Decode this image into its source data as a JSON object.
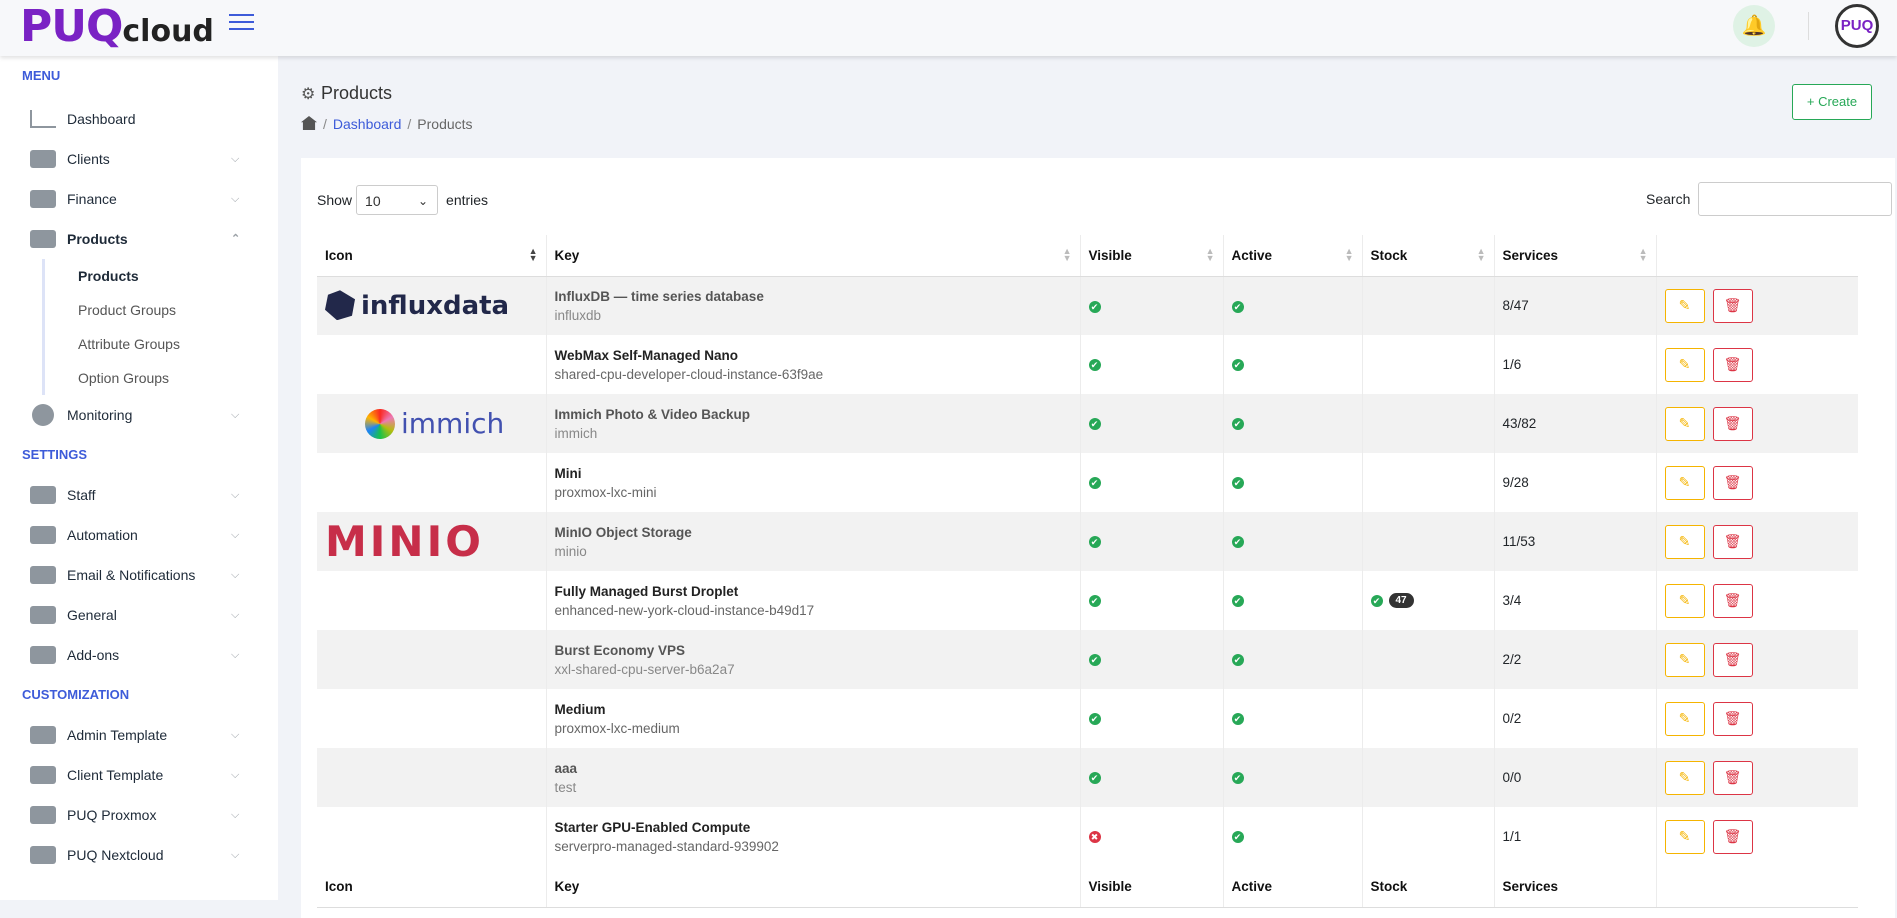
{
  "brand": {
    "logo_main": "PUQ",
    "logo_sub": "cloud"
  },
  "header": {
    "avatar_text": "PUQ"
  },
  "sidebar": {
    "sections": {
      "menu": "MENU",
      "settings": "SETTINGS",
      "customization": "CUSTOMIZATION"
    },
    "menu_items": [
      {
        "label": "Dashboard"
      },
      {
        "label": "Clients"
      },
      {
        "label": "Finance"
      },
      {
        "label": "Products"
      }
    ],
    "product_sub": [
      {
        "label": "Products"
      },
      {
        "label": "Product Groups"
      },
      {
        "label": "Attribute Groups"
      },
      {
        "label": "Option Groups"
      }
    ],
    "monitoring": {
      "label": "Monitoring"
    },
    "settings_items": [
      {
        "label": "Staff"
      },
      {
        "label": "Automation"
      },
      {
        "label": "Email & Notifications"
      },
      {
        "label": "General"
      },
      {
        "label": "Add-ons"
      }
    ],
    "custom_items": [
      {
        "label": "Admin Template"
      },
      {
        "label": "Client Template"
      },
      {
        "label": "PUQ Proxmox"
      },
      {
        "label": "PUQ Nextcloud"
      }
    ]
  },
  "page": {
    "title": "Products",
    "breadcrumb": {
      "dashboard": "Dashboard",
      "current": "Products"
    },
    "create_label": "+ Create"
  },
  "table_controls": {
    "show_label": "Show",
    "entries_value": "10",
    "entries_label": "entries",
    "search_label": "Search"
  },
  "table": {
    "headers": {
      "icon": "Icon",
      "key": "Key",
      "visible": "Visible",
      "active": "Active",
      "stock": "Stock",
      "services": "Services"
    },
    "rows": [
      {
        "logo": "influxdata",
        "title": "InfluxDB — time series database",
        "key": "influxdb",
        "visible": true,
        "active": true,
        "stock": "",
        "services": "8/47"
      },
      {
        "logo": "",
        "title": "WebMax Self-Managed Nano",
        "key": "shared-cpu-developer-cloud-instance-63f9ae",
        "visible": true,
        "active": true,
        "stock": "",
        "services": "1/6"
      },
      {
        "logo": "immich",
        "title": "Immich Photo & Video Backup",
        "key": "immich",
        "visible": true,
        "active": true,
        "stock": "",
        "services": "43/82"
      },
      {
        "logo": "",
        "title": "Mini",
        "key": "proxmox-lxc-mini",
        "visible": true,
        "active": true,
        "stock": "",
        "services": "9/28"
      },
      {
        "logo": "MINIO",
        "title": "MinIO Object Storage",
        "key": "minio",
        "visible": true,
        "active": true,
        "stock": "",
        "services": "11/53"
      },
      {
        "logo": "",
        "title": "Fully Managed Burst Droplet",
        "key": "enhanced-new-york-cloud-instance-b49d17",
        "visible": true,
        "active": true,
        "stock": "47",
        "services": "3/4"
      },
      {
        "logo": "",
        "title": "Burst Economy VPS",
        "key": "xxl-shared-cpu-server-b6a2a7",
        "visible": true,
        "active": true,
        "stock": "",
        "services": "2/2"
      },
      {
        "logo": "",
        "title": "Medium",
        "key": "proxmox-lxc-medium",
        "visible": true,
        "active": true,
        "stock": "",
        "services": "0/2"
      },
      {
        "logo": "",
        "title": "aaa",
        "key": "test",
        "visible": true,
        "active": true,
        "stock": "",
        "services": "0/0"
      },
      {
        "logo": "",
        "title": "Starter GPU-Enabled Compute",
        "key": "serverpro-managed-standard-939902",
        "visible": false,
        "active": true,
        "stock": "",
        "services": "1/1"
      }
    ]
  }
}
